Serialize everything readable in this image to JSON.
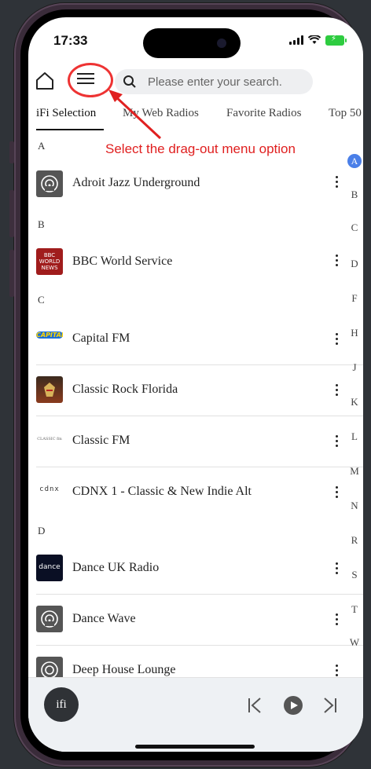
{
  "status_bar": {
    "time": "17:33"
  },
  "header": {
    "search_placeholder": "Please enter your search."
  },
  "tabs": [
    {
      "label": "iFi Selection",
      "active": true
    },
    {
      "label": "My Web Radios",
      "active": false
    },
    {
      "label": "Favorite Radios",
      "active": false
    },
    {
      "label": "Top 50",
      "active": false
    }
  ],
  "sections": {
    "A": "A",
    "B": "B",
    "C": "C",
    "D": "D"
  },
  "stations": [
    {
      "name": "Adroit Jazz Underground",
      "thumb": "radio-placeholder-icon"
    },
    {
      "name": "BBC World Service",
      "thumb": "bbc-world-news-logo",
      "thumb_text": "BBC WORLD NEWS"
    },
    {
      "name": "Capital FM",
      "thumb": "capital-fm-logo",
      "thumb_text": "CAPITAL"
    },
    {
      "name": "Classic Rock Florida",
      "thumb": "classic-rock-florida-logo"
    },
    {
      "name": "Classic FM",
      "thumb": "classic-fm-logo",
      "thumb_text": "CLASSIC fm"
    },
    {
      "name": "CDNX 1 - Classic & New Indie Alt",
      "thumb": "cdnx-logo",
      "thumb_text": "cdnx"
    },
    {
      "name": "Dance UK Radio",
      "thumb": "dance-uk-logo",
      "thumb_text": "dance"
    },
    {
      "name": "Dance Wave",
      "thumb": "radio-placeholder-icon"
    },
    {
      "name": "Deep House Lounge",
      "thumb": "radio-placeholder-icon"
    }
  ],
  "alphabet_index": [
    "A",
    "B",
    "C",
    "D",
    "F",
    "H",
    "J",
    "K",
    "L",
    "M",
    "N",
    "R",
    "S",
    "T",
    "W"
  ],
  "alphabet_active": "A",
  "player": {
    "avatar_label": "ifi"
  },
  "annotation": {
    "text": "Select the drag-out menu option",
    "color": "#e02020"
  },
  "colors": {
    "accent": "#4a7fe8",
    "annotation": "#e02020"
  }
}
